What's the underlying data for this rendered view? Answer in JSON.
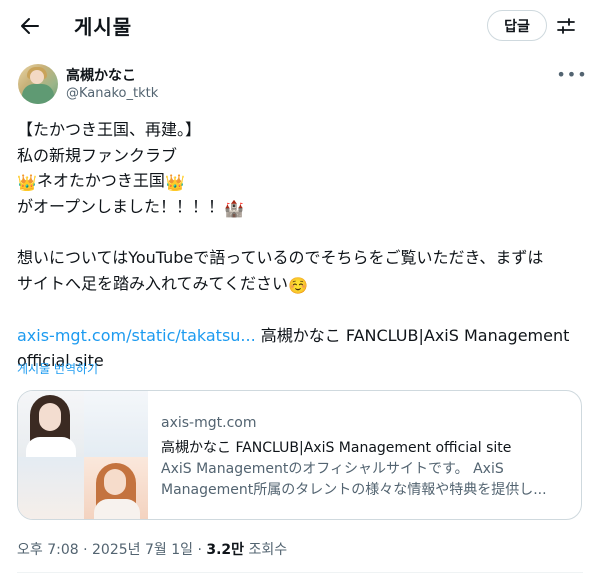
{
  "header": {
    "title": "게시물",
    "reply_label": "답글",
    "back_icon": "arrow-left-icon",
    "adjust_icon": "adjust-icon"
  },
  "author": {
    "name": "高槻かなこ",
    "handle": "@Kanako_tktk"
  },
  "post": {
    "line1": "【たかつき王国、再建。】",
    "line2": "私の新規ファンクラブ",
    "line3_emoji_a": "👑",
    "line3_text": "ネオたかつき王国",
    "line3_emoji_b": "👑",
    "line4_text": "がオープンしました！！！！",
    "line4_emoji": "🏰",
    "line5": "想いについてはYouTubeで語っているのでそちらをご覧いただき、まずは",
    "line6_text": "サイトへ足を踏み入れてみてください",
    "line6_emoji": "☺️",
    "link_text": "axis-mgt.com/static/takatsu...",
    "link_suffix": " 高槻かなこ FANCLUB|AxiS Management",
    "link_suffix2": "official site",
    "translate": "게시물 번역하기"
  },
  "card": {
    "domain": "axis-mgt.com",
    "title": "高槻かなこ FANCLUB|AxiS Management official site",
    "desc_line1": "AxiS Managementのオフィシャルサイトです。 AxiS",
    "desc_line2": "Management所属のタレントの様々な情報や特典を提供し..."
  },
  "meta": {
    "time": "오후 7:08",
    "date": "2025년 7월 1일",
    "views": "3.2만",
    "views_label": "조회수"
  },
  "colors": {
    "accent": "#1d9bf0",
    "secondary_text": "#536471",
    "border": "#cfd9de"
  }
}
